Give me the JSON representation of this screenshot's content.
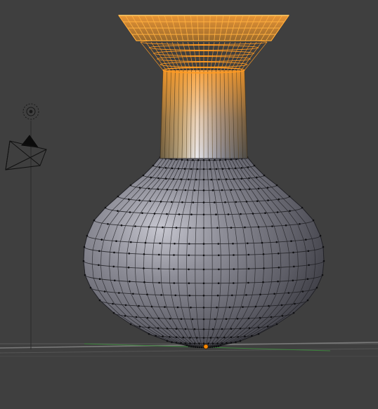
{
  "viewport": {
    "background_color": "#3f3f3f",
    "mode": "edit-mode-wireframe"
  },
  "mesh": {
    "object_type": "vase",
    "body_color": "#8a8a94",
    "edge_color": "#1e1e22",
    "selected_color": "#ff9a22",
    "selected_region": "neck-and-rim"
  },
  "scene": {
    "ground_line_color": "#7a7a7a",
    "x_axis_color": "#a03c3c",
    "y_axis_color": "#3c8c3c",
    "origin_marker_color": "#ff8a00"
  },
  "icons": {
    "lamp": "lamp-icon",
    "camera": "camera-icon"
  }
}
